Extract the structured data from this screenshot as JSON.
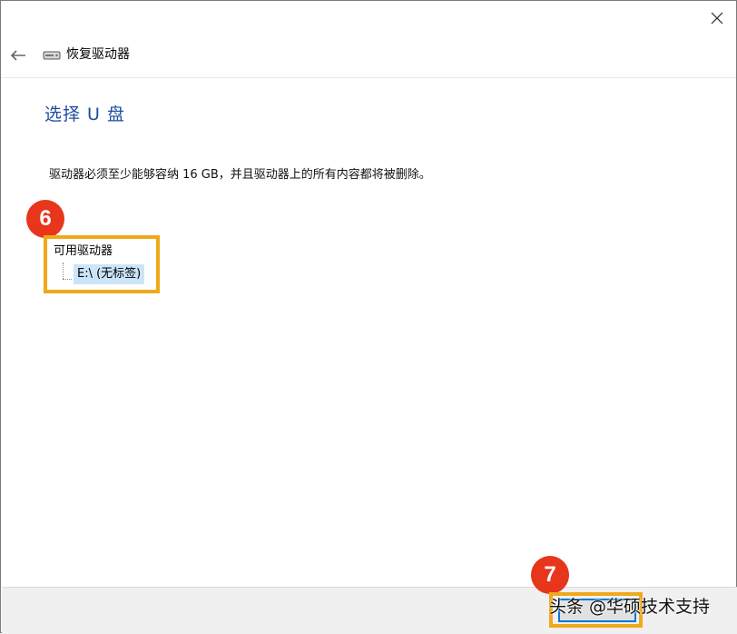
{
  "window": {
    "title": "恢复驱动器",
    "close_icon": "close-icon",
    "back_icon": "back-arrow-icon",
    "drive_icon": "drive-icon"
  },
  "page": {
    "title": "选择 U 盘",
    "description": "驱动器必须至少能够容纳 16 GB，并且驱动器上的所有内容都将被删除。"
  },
  "tree": {
    "header": "可用驱动器",
    "items": [
      {
        "label": "E:\\ (无标签)",
        "selected": true
      }
    ]
  },
  "annotations": {
    "step6": "6",
    "step7": "7",
    "highlight_color": "#f0a91c",
    "badge_color": "#e8361c"
  },
  "footer": {
    "next_label": ""
  },
  "watermark": "头条 @华硕技术支持",
  "colors": {
    "title_blue": "#1f4e9e",
    "selection": "#cce4f7",
    "footer_bg": "#f0f0f0"
  }
}
